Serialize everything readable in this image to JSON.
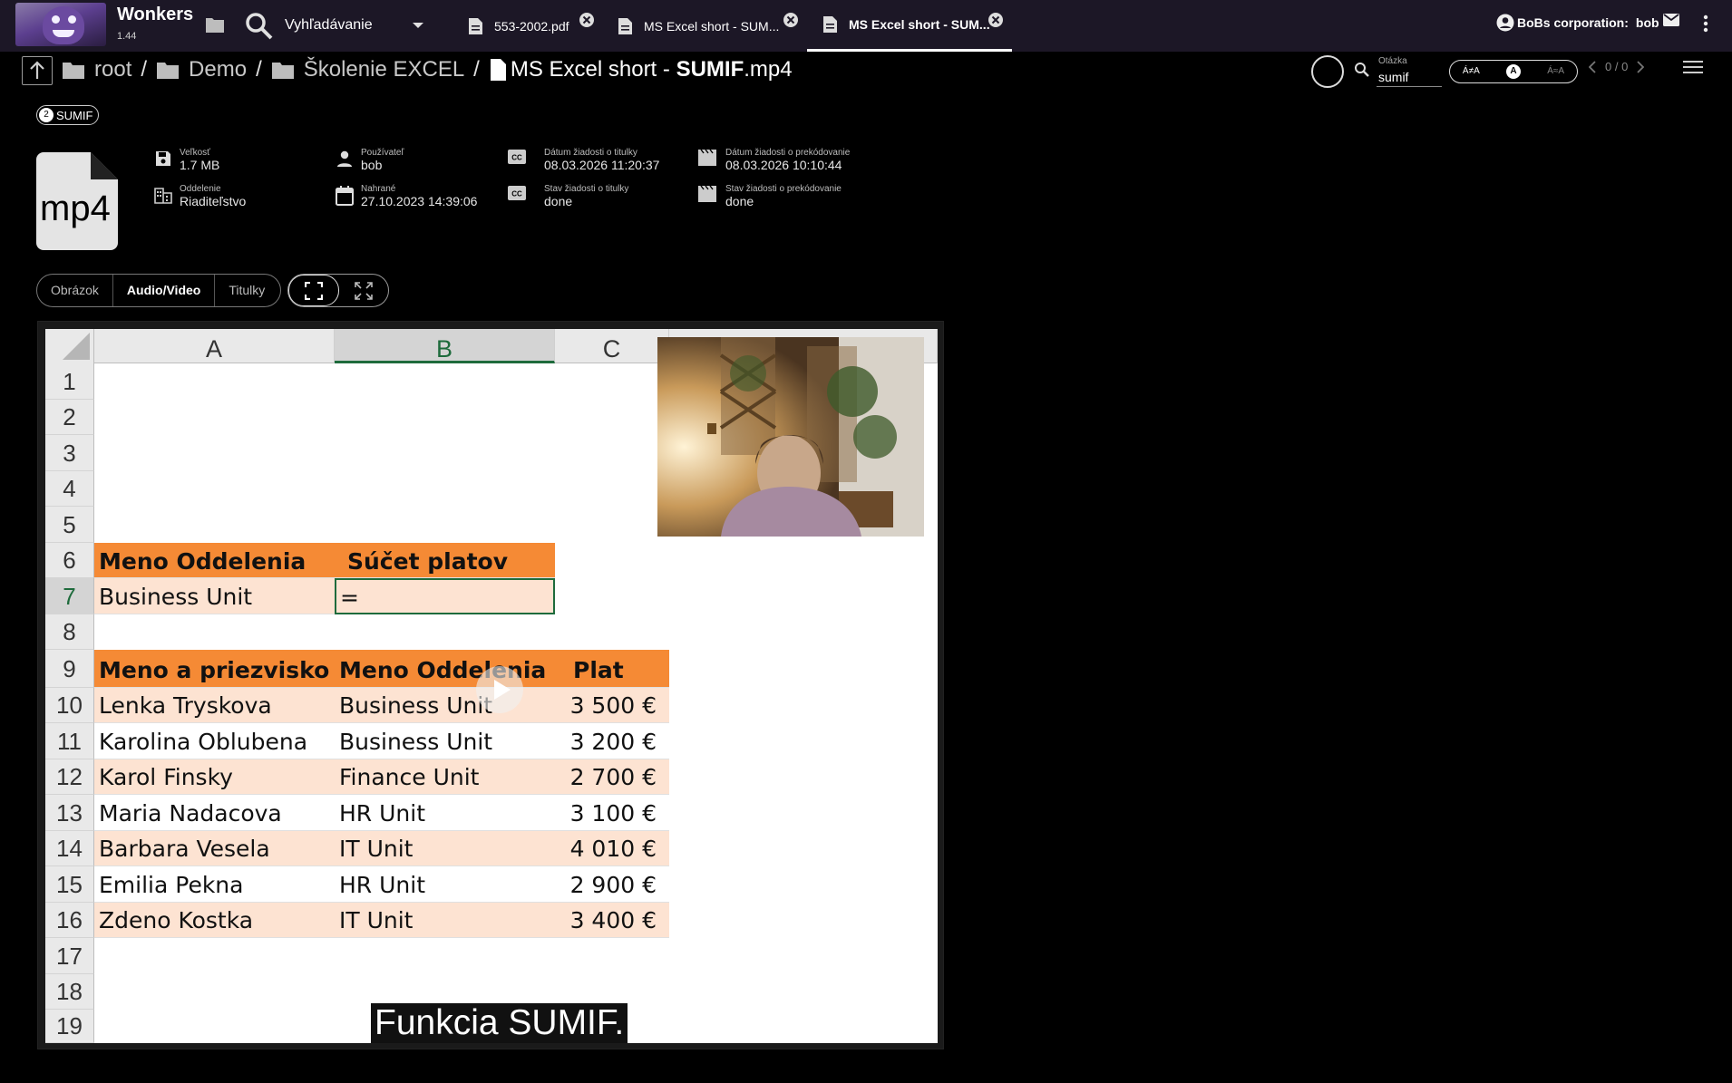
{
  "app": {
    "name": "Wonkers",
    "version": "1.44"
  },
  "topbar": {
    "search_label": "Vyhľadávanie",
    "tabs": [
      {
        "label": "553-2002.pdf",
        "active": false
      },
      {
        "label": "MS Excel short - SUM...",
        "active": false
      },
      {
        "label": "MS Excel short - SUM...",
        "active": true
      }
    ],
    "org": "BoBs corporation:",
    "user": "bob"
  },
  "breadcrumb": {
    "items": [
      "root",
      "Demo",
      "Školenie EXCEL"
    ],
    "file_prefix": "MS Excel short - ",
    "file_bold": "SUMIF",
    "file_ext": ".mp4"
  },
  "question": {
    "label": "Otázka",
    "value": "sumif"
  },
  "match_toggle": [
    "Á≠A",
    "A",
    "Á≈A"
  ],
  "pager": "0 / 0",
  "tag": {
    "count": "2",
    "label": "SUMIF"
  },
  "file": {
    "type": "mp4",
    "size_label": "Veľkosť",
    "size": "1.7 MB",
    "department_label": "Oddelenie",
    "department": "Riaditeľstvo",
    "user_label": "Používateľ",
    "user": "bob",
    "uploaded_label": "Nahrané",
    "uploaded": "27.10.2023 14:39:06",
    "sub_request_date_label": "Dátum žiadosti o titulky",
    "sub_request_date": "08.03.2026 11:20:37",
    "sub_status_label": "Stav žiadosti o titulky",
    "sub_status": "done",
    "dub_request_date_label": "Dátum žiadosti o prekódovanie",
    "dub_request_date": "08.03.2026 10:10:44",
    "dub_status_label": "Stav žiadosti o prekódovanie",
    "dub_status": "done"
  },
  "view_tabs": [
    {
      "label": "Obrázok",
      "active": false
    },
    {
      "label": "Audio/Video",
      "active": true
    },
    {
      "label": "Titulky",
      "active": false
    }
  ],
  "sheet": {
    "columns": [
      "A",
      "B",
      "C"
    ],
    "rows": [
      "1",
      "2",
      "3",
      "4",
      "5",
      "6",
      "7",
      "8",
      "9",
      "10",
      "11",
      "12",
      "13",
      "14",
      "15",
      "16",
      "17",
      "18",
      "19"
    ],
    "summary_headers": [
      "Meno Oddelenia",
      "Súčet platov"
    ],
    "summary_row": {
      "dept": "Business Unit",
      "formula": "="
    },
    "table_headers": [
      "Meno a priezvisko",
      "Meno Oddelenia",
      "Plat"
    ],
    "table_rows": [
      [
        "Lenka Tryskova",
        "Business Unit",
        "3 500 €"
      ],
      [
        "Karolina Oblubena",
        "Business Unit",
        "3 200 €"
      ],
      [
        "Karol Finsky",
        "Finance Unit",
        "2 700 €"
      ],
      [
        "Maria Nadacova",
        "HR Unit",
        "3 100 €"
      ],
      [
        "Barbara Vesela",
        "IT Unit",
        "4 010 €"
      ],
      [
        "Emilia Pekna",
        "HR Unit",
        "2 900 €"
      ],
      [
        "Zdeno Kostka",
        "IT Unit",
        "3 400 €"
      ]
    ]
  },
  "subtitle": "Funkcia SUMIF.",
  "colors": {
    "topbar": "#1c1726",
    "excel_header": "#f58a35",
    "excel_band": "#fde3d2",
    "excel_green": "#1e6b3c"
  }
}
